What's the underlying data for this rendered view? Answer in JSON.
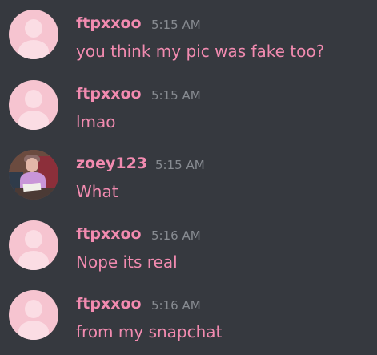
{
  "colors": {
    "background": "#36393f",
    "accent": "#f28bb0",
    "timestamp": "#878b91",
    "default_avatar": "#f6c4d0"
  },
  "messages": [
    {
      "username": "ftpxxoo",
      "time": "5:15 AM",
      "text": "you think my pic was fake too?",
      "avatar": "default-avatar-icon"
    },
    {
      "username": "ftpxxoo",
      "time": "5:15 AM",
      "text": "lmao",
      "avatar": "default-avatar-icon"
    },
    {
      "username": "zoey123",
      "time": "5:15 AM",
      "text": "What",
      "avatar": "profile-photo"
    },
    {
      "username": "ftpxxoo",
      "time": "5:16 AM",
      "text": "Nope its real",
      "avatar": "default-avatar-icon"
    },
    {
      "username": "ftpxxoo",
      "time": "5:16 AM",
      "text": "from my snapchat",
      "avatar": "default-avatar-icon"
    }
  ]
}
